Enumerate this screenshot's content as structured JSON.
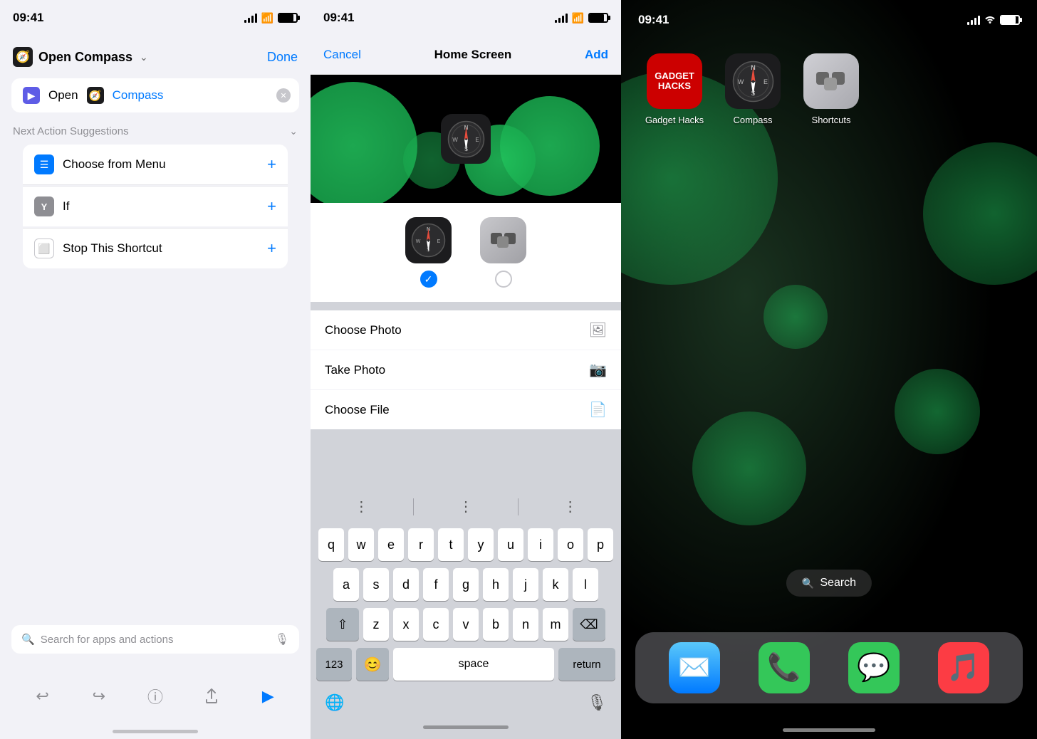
{
  "panel1": {
    "status": {
      "time": "09:41"
    },
    "nav": {
      "title": "Open Compass",
      "done_label": "Done"
    },
    "action": {
      "open_label": "Open",
      "compass_label": "Compass"
    },
    "suggestions": {
      "title": "Next Action Suggestions",
      "items": [
        {
          "label": "Choose from Menu",
          "icon": "menu"
        },
        {
          "label": "If",
          "icon": "if"
        },
        {
          "label": "Stop This Shortcut",
          "icon": "stop"
        }
      ]
    },
    "search": {
      "placeholder": "Search for apps and actions"
    },
    "toolbar": {
      "undo_label": "↩",
      "redo_label": "↪",
      "info_label": "ℹ",
      "share_label": "↑",
      "play_label": "▶"
    }
  },
  "panel2": {
    "status": {
      "time": "09:41"
    },
    "nav": {
      "cancel_label": "Cancel",
      "title": "Home Screen",
      "add_label": "Add"
    },
    "options": [
      {
        "label": "Choose Photo",
        "icon": "photo"
      },
      {
        "label": "Take Photo",
        "icon": "camera"
      },
      {
        "label": "Choose File",
        "icon": "file"
      }
    ],
    "keyboard": {
      "rows": [
        [
          "q",
          "w",
          "e",
          "r",
          "t",
          "y",
          "u",
          "i",
          "o",
          "p"
        ],
        [
          "a",
          "s",
          "d",
          "f",
          "g",
          "h",
          "j",
          "k",
          "l"
        ],
        [
          "⇧",
          "z",
          "x",
          "c",
          "v",
          "b",
          "n",
          "m",
          "⌫"
        ],
        [
          "123",
          "😊",
          "space",
          "return"
        ]
      ],
      "space_label": "space",
      "return_label": "return"
    }
  },
  "panel3": {
    "status": {
      "time": "09:41"
    },
    "apps": [
      {
        "label": "Gadget Hacks",
        "icon": "gadget"
      },
      {
        "label": "Compass",
        "icon": "compass"
      },
      {
        "label": "Shortcuts",
        "icon": "shortcuts"
      }
    ],
    "search": {
      "label": "Search"
    },
    "dock": [
      {
        "label": "Mail",
        "icon": "mail"
      },
      {
        "label": "Phone",
        "icon": "phone"
      },
      {
        "label": "Messages",
        "icon": "messages"
      },
      {
        "label": "Music",
        "icon": "music"
      }
    ]
  }
}
